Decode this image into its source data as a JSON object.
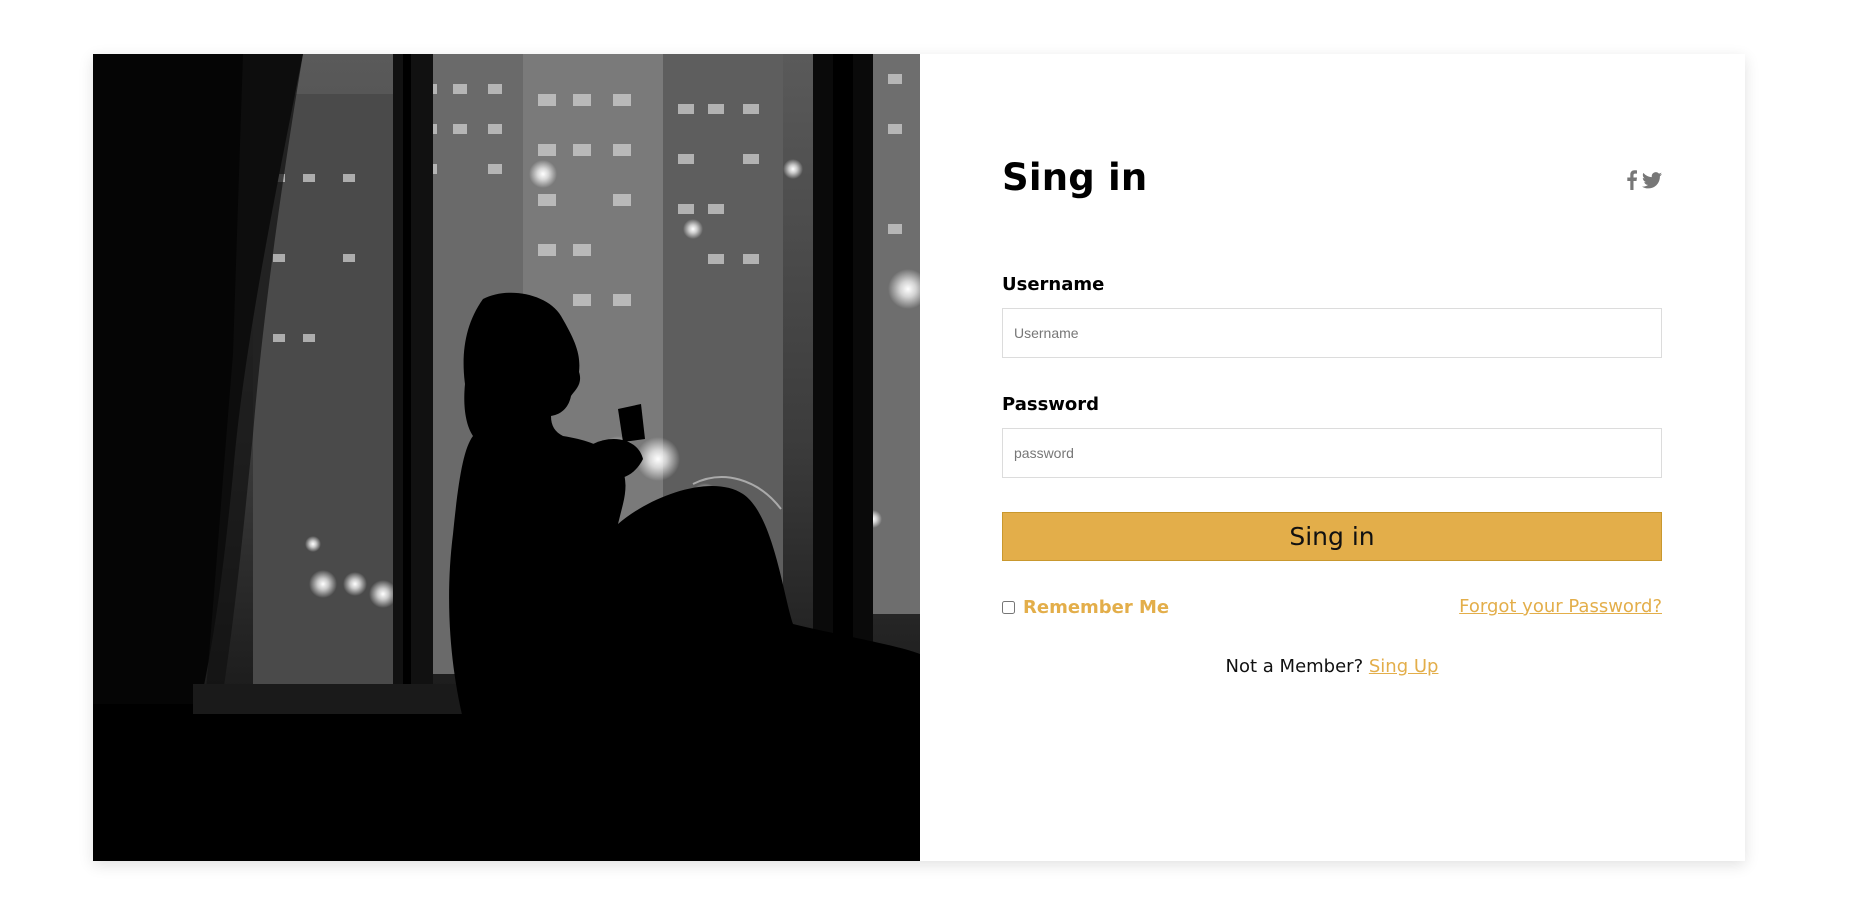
{
  "hero_image": {
    "icon": "person-silhouette-by-night-window-photo"
  },
  "form": {
    "title": "Sing in",
    "social": {
      "facebook_icon": "facebook-icon",
      "twitter_icon": "twitter-icon"
    },
    "username": {
      "label": "Username",
      "placeholder": "Username",
      "value": ""
    },
    "password": {
      "label": "Password",
      "placeholder": "password",
      "value": ""
    },
    "submit_label": "Sing in",
    "remember_label": "Remember Me",
    "remember_checked": false,
    "forgot_label": "Forgot your Password?",
    "not_member_text": "Not a Member?",
    "signup_label": "Sing Up"
  },
  "colors": {
    "accent": "#e3ae4a",
    "title": "#000000",
    "social_icon": "#777777"
  }
}
